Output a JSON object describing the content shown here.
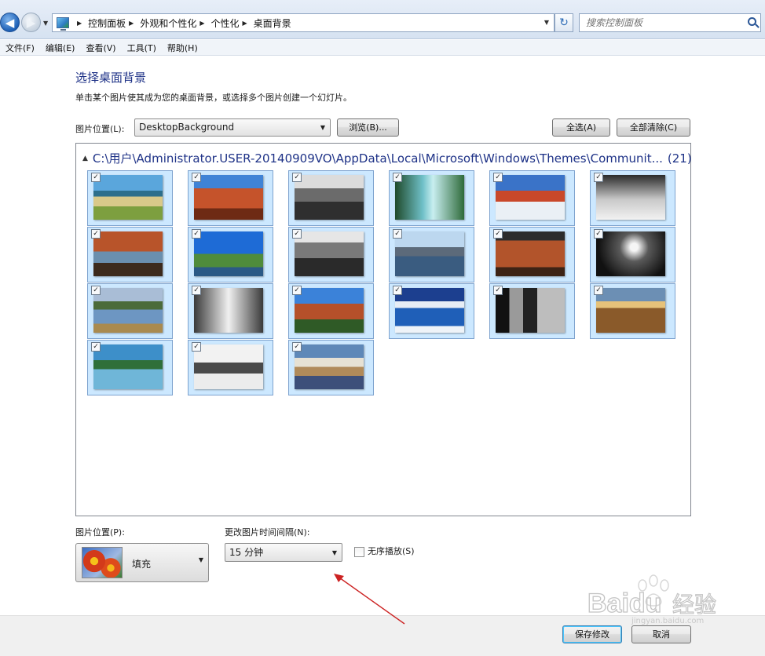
{
  "address": {
    "breadcrumbs": [
      "控制面板",
      "外观和个性化",
      "个性化",
      "桌面背景"
    ],
    "search_placeholder": "搜索控制面板"
  },
  "menu": [
    "文件(F)",
    "编辑(E)",
    "查看(V)",
    "工具(T)",
    "帮助(H)"
  ],
  "page": {
    "title": "选择桌面背景",
    "subtitle": "单击某个图片使其成为您的桌面背景，或选择多个图片创建一个幻灯片。"
  },
  "location": {
    "label": "图片位置(L):",
    "value": "DesktopBackground",
    "browse": "浏览(B)...",
    "select_all": "全选(A)",
    "clear_all": "全部清除(C)"
  },
  "gallery": {
    "group_path": "C:\\用户\\Administrator.USER-20140909VO\\AppData\\Local\\Microsoft\\Windows\\Themes\\Communit...",
    "group_count": "(21)",
    "thumbnails": [
      {
        "checked": true,
        "scene": "coast-dunes"
      },
      {
        "checked": true,
        "scene": "red-rock-canyon"
      },
      {
        "checked": true,
        "scene": "bw-desert-cactus"
      },
      {
        "checked": true,
        "scene": "waterfall-forest"
      },
      {
        "checked": true,
        "scene": "snowy-red-cliffs"
      },
      {
        "checked": true,
        "scene": "bw-snow-forest"
      },
      {
        "checked": true,
        "scene": "autumn-river"
      },
      {
        "checked": true,
        "scene": "coastal-blue-sky"
      },
      {
        "checked": true,
        "scene": "bw-mountains"
      },
      {
        "checked": true,
        "scene": "mountain-lake-reflection"
      },
      {
        "checked": true,
        "scene": "sunlit-red-mountain"
      },
      {
        "checked": true,
        "scene": "bw-lone-tree"
      },
      {
        "checked": true,
        "scene": "lake-reflection"
      },
      {
        "checked": true,
        "scene": "bw-waterfall"
      },
      {
        "checked": true,
        "scene": "red-butte"
      },
      {
        "checked": true,
        "scene": "blue-lake-mountains"
      },
      {
        "checked": true,
        "scene": "bw-forest"
      },
      {
        "checked": true,
        "scene": "sunset-valley"
      },
      {
        "checked": true,
        "scene": "ocean-cliff"
      },
      {
        "checked": true,
        "scene": "bw-snowy-trees"
      },
      {
        "checked": true,
        "scene": "beach-clouds"
      }
    ]
  },
  "position": {
    "label": "图片位置(P):",
    "value": "填充"
  },
  "interval": {
    "label": "更改图片时间间隔(N):",
    "value": "15 分钟"
  },
  "shuffle": {
    "label": "无序播放(S)",
    "checked": false
  },
  "footer": {
    "save": "保存修改",
    "cancel": "取消"
  },
  "watermark": {
    "brand": "Baidu",
    "brand_cn": "经验",
    "url": "jingyan.baidu.com"
  },
  "colors": {
    "accent_title": "#1e3287",
    "thumb_selected_bg": "#cce8ff",
    "annotation_arrow": "#cc2222"
  }
}
